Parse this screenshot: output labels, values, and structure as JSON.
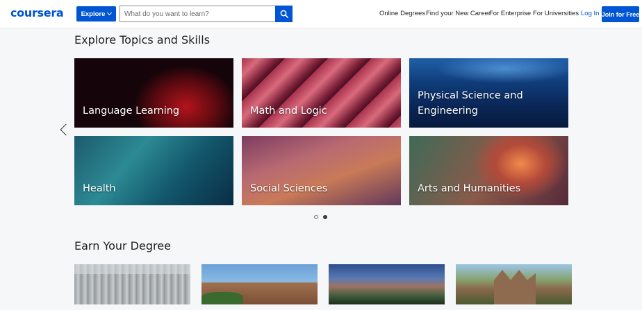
{
  "header": {
    "logo": "coursera",
    "explore_label": "Explore",
    "search_placeholder": "What do you want to learn?",
    "nav": [
      "Online Degrees",
      "Find your New Career",
      "For Enterprise",
      "For Universities"
    ],
    "login_label": "Log In",
    "join_label": "Join for Free"
  },
  "topics": {
    "title": "Explore Topics and Skills",
    "cards": [
      {
        "label": "Language Learning"
      },
      {
        "label": "Math and Logic"
      },
      {
        "label": "Physical Science and Engineering"
      },
      {
        "label": "Health"
      },
      {
        "label": "Social Sciences"
      },
      {
        "label": "Arts and Humanities"
      }
    ],
    "carousel": {
      "pages": 2,
      "active_page": 2
    }
  },
  "degrees": {
    "title": "Earn Your Degree"
  },
  "colors": {
    "brand_blue": "#0056d2",
    "page_bg": "#f5f7f8"
  },
  "icons": [
    "search-icon",
    "chevron-down-icon",
    "chevron-left-icon"
  ]
}
